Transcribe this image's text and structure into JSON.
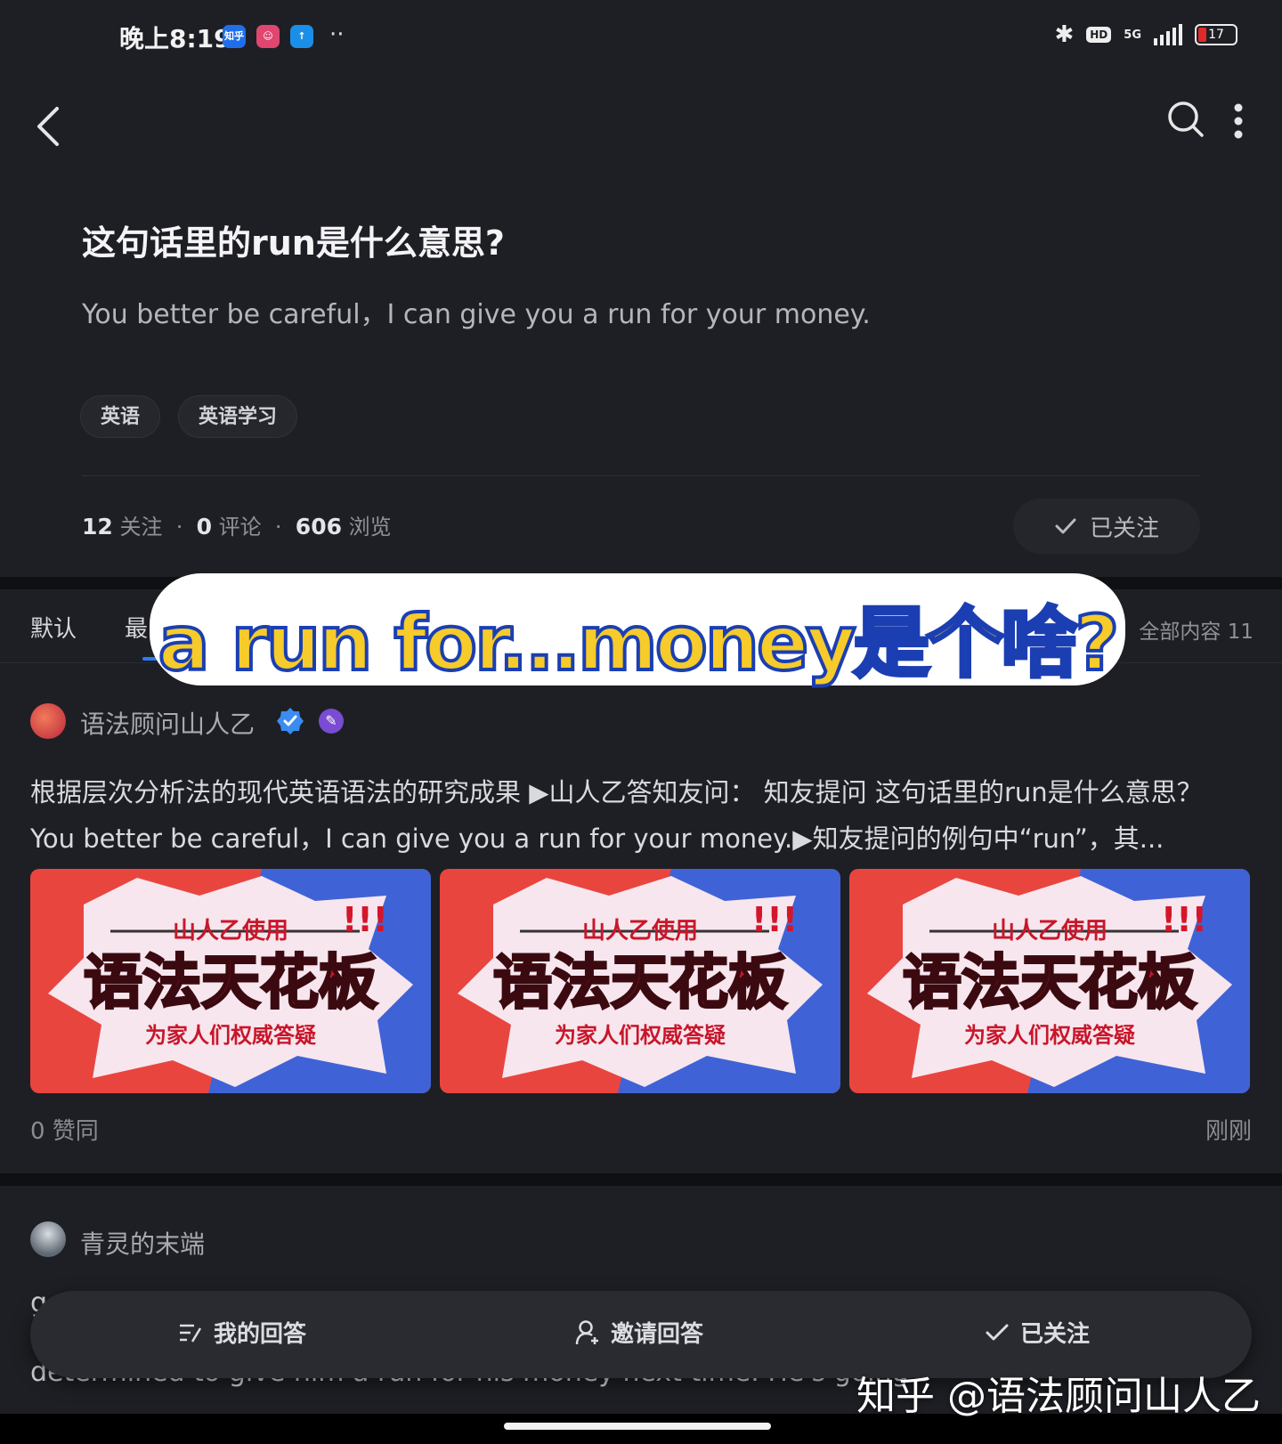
{
  "status_bar": {
    "time": "晚上8:19",
    "zhihu_icon_label": "知乎",
    "dots": "··",
    "hd": "HD",
    "network": "5G",
    "battery": "17"
  },
  "question": {
    "title": "这句话里的run是什么意思?",
    "description": "You better be careful，I can give you a run for your money.",
    "tags": [
      "英语",
      "英语学习"
    ],
    "stats": {
      "follow_count": "12",
      "follow_label": "关注",
      "comment_count": "0",
      "comment_label": "评论",
      "view_count": "606",
      "view_label": "浏览"
    },
    "follow_button": "已关注"
  },
  "sort": {
    "tabs": [
      "默认",
      "最"
    ],
    "all_content": "全部内容 11"
  },
  "overlay_title": "a run for...money是个啥?",
  "answers": [
    {
      "author": "语法顾问山人乙",
      "excerpt": "根据层次分析法的现代英语语法的研究成果 ▶山人乙答知友问： 知友提问 这句话里的run是什么意思？ You better be careful，I can give you a run for your money.▶知友提问的例句中“run”，其...",
      "images": [
        {
          "top": "山人乙使用",
          "main": "语法天花板",
          "sub": "为家人们权威答疑",
          "marks": "!!!"
        },
        {
          "top": "山人乙使用",
          "main": "语法天花板",
          "sub": "为家人们权威答疑",
          "marks": "!!!"
        },
        {
          "top": "山人乙使用",
          "main": "语法天花板",
          "sub": "为家人们权威答疑",
          "marks": "!!!"
        }
      ],
      "votes": "0 赞同",
      "time": "刚刚"
    },
    {
      "author": "青灵的末端",
      "line1": "g",
      "line2": "determined to give him a run for his money next time. He's going s"
    }
  ],
  "action_bar": {
    "my_answer": "我的回答",
    "invite": "邀请回答",
    "following": "已关注"
  },
  "watermark": "知乎 @语法顾问山人乙",
  "colors": {
    "background": "#1e1f24",
    "accent_blue": "#2a7cf6",
    "overlay_yellow": "#f6cb2a",
    "overlay_stroke": "#1b3fb2"
  }
}
